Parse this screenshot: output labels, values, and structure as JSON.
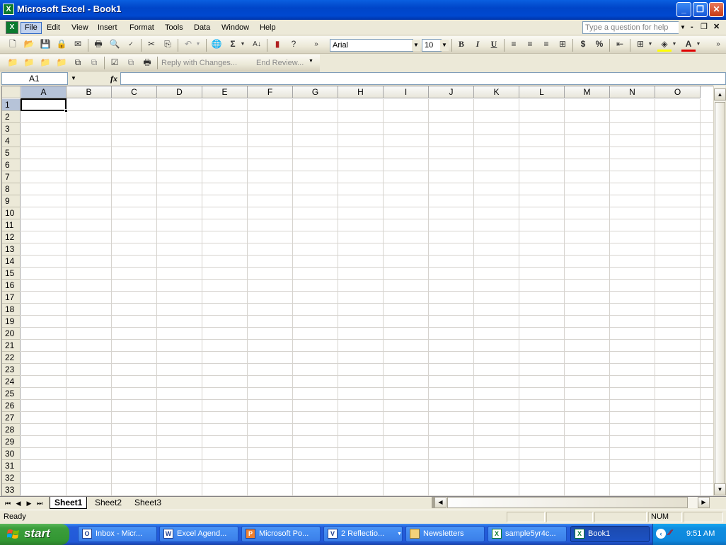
{
  "window": {
    "title": "Microsoft Excel - Book1",
    "app_icon": "excel-icon",
    "caption_buttons": [
      "minimize-icon",
      "restore-icon",
      "close-icon"
    ]
  },
  "menu": {
    "items": [
      "File",
      "Edit",
      "View",
      "Insert",
      "Format",
      "Tools",
      "Data",
      "Window",
      "Help"
    ],
    "active": "File",
    "help_placeholder": "Type a question for help"
  },
  "standard_toolbar": {
    "font_name": "Arial",
    "font_size": "10",
    "bold": "B",
    "italic": "I",
    "underline": "U",
    "currency": "$",
    "percent": "%",
    "autosum": "Σ",
    "font_color_glyph": "A"
  },
  "reviewing_toolbar": {
    "reply_with_changes": "Reply with Changes...",
    "end_review": "End Review..."
  },
  "formula_bar": {
    "name_box": "A1",
    "fx": "fx",
    "formula": ""
  },
  "grid": {
    "columns": [
      "A",
      "B",
      "C",
      "D",
      "E",
      "F",
      "G",
      "H",
      "I",
      "J",
      "K",
      "L",
      "M",
      "N",
      "O"
    ],
    "rows": [
      "1",
      "2",
      "3",
      "4",
      "5",
      "6",
      "7",
      "8",
      "9",
      "10",
      "11",
      "12",
      "13",
      "14",
      "15",
      "16",
      "17",
      "18",
      "19",
      "20",
      "21",
      "22",
      "23",
      "24",
      "25",
      "26",
      "27",
      "28",
      "29",
      "30",
      "31",
      "32",
      "33"
    ],
    "active_cell": "A1"
  },
  "sheets": {
    "tabs": [
      "Sheet1",
      "Sheet2",
      "Sheet3"
    ],
    "active": "Sheet1"
  },
  "status": {
    "left": "Ready",
    "num": "NUM"
  },
  "taskbar": {
    "start_label": "start",
    "tasks": [
      {
        "label": "Inbox - Micr...",
        "icon": "outlook-icon"
      },
      {
        "label": "Excel Agend...",
        "icon": "word-icon"
      },
      {
        "label": "Microsoft Po...",
        "icon": "powerpoint-icon"
      },
      {
        "label": "2 Reflectio...",
        "icon": "reflection-icon"
      },
      {
        "label": "Newsletters",
        "icon": "folder-icon"
      },
      {
        "label": "sample5yr4c...",
        "icon": "excel-icon"
      },
      {
        "label": "Book1",
        "icon": "excel-icon"
      }
    ],
    "active_task": "Book1",
    "clock": "9:51 AM"
  }
}
